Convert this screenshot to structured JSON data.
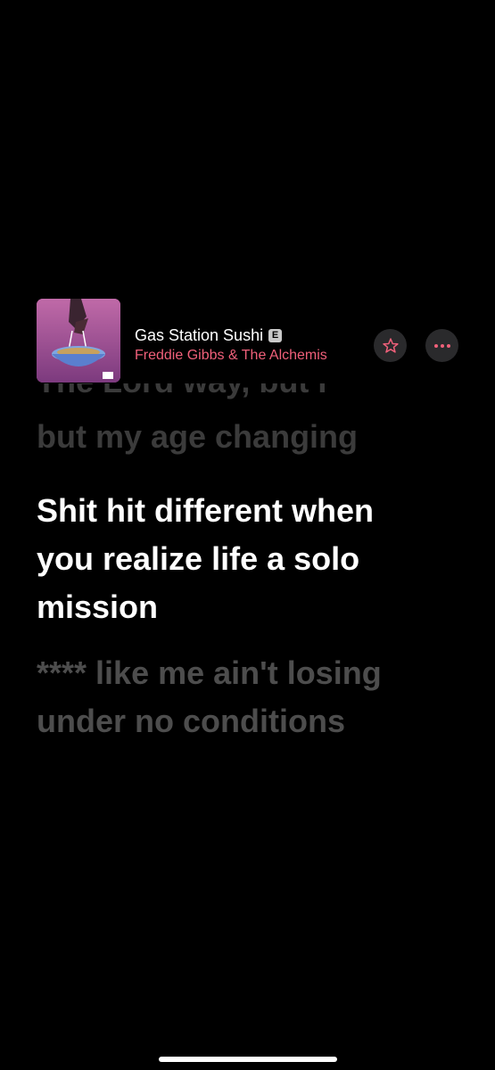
{
  "now_playing": {
    "title": "Gas Station Sushi",
    "explicit_badge": "E",
    "artist": "Freddie Gibbs & The Alchemis",
    "artwork_icon": "album-artwork-icon",
    "favorite_icon": "star-icon",
    "more_icon": "ellipsis-icon",
    "accent_color": "#f0607a"
  },
  "lyrics": {
    "previous_partial": "The Lord way, but I",
    "previous_line": "but my age changing",
    "current_lines": [
      "Shit hit different when",
      "you realize life a solo",
      "mission"
    ],
    "next_lines": [
      "**** like me ain't losing",
      "under no conditions"
    ]
  }
}
